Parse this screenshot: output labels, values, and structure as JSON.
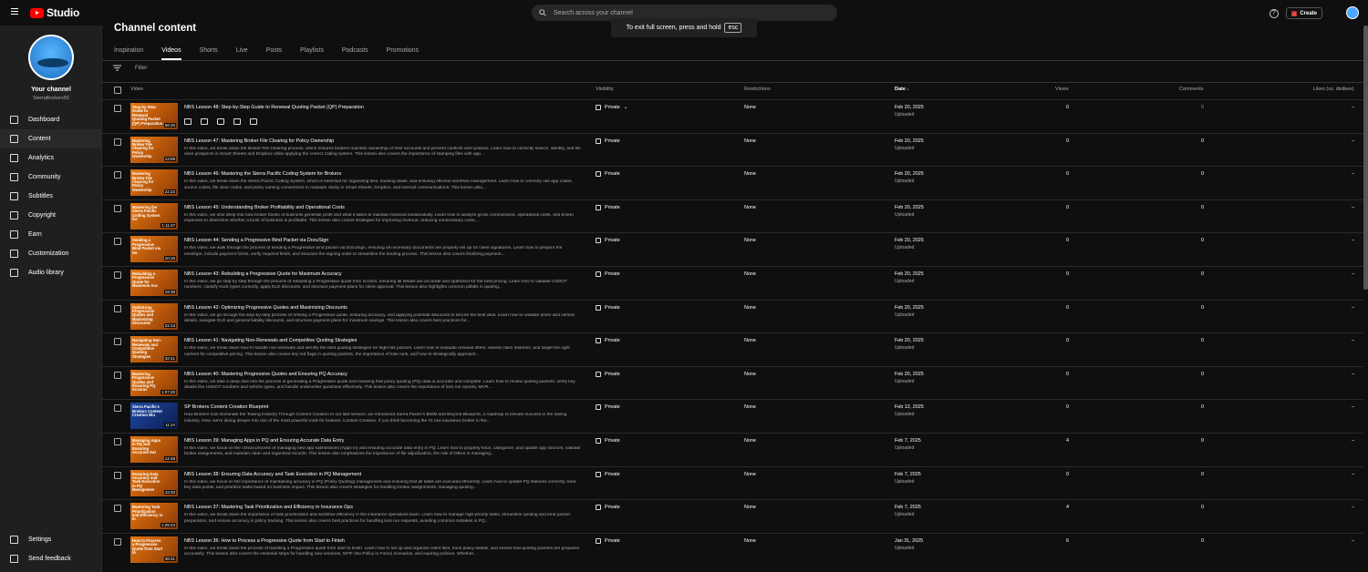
{
  "header": {
    "logo_text": "Studio",
    "search_placeholder": "Search across your channel",
    "create_label": "Create",
    "toast_text": "To exit full screen, press and hold",
    "toast_key": "esc"
  },
  "sidebar": {
    "channel_title": "Your channel",
    "channel_handle": "SierraBrokers50",
    "items": [
      {
        "label": "Dashboard",
        "icon": "dashboard-icon"
      },
      {
        "label": "Content",
        "icon": "content-icon",
        "active": true
      },
      {
        "label": "Analytics",
        "icon": "analytics-icon"
      },
      {
        "label": "Community",
        "icon": "community-icon"
      },
      {
        "label": "Subtitles",
        "icon": "subtitles-icon"
      },
      {
        "label": "Copyright",
        "icon": "copyright-icon"
      },
      {
        "label": "Earn",
        "icon": "earn-icon"
      },
      {
        "label": "Customization",
        "icon": "customization-icon"
      },
      {
        "label": "Audio library",
        "icon": "audio-library-icon"
      }
    ],
    "bottom_items": [
      {
        "label": "Settings",
        "icon": "settings-icon"
      },
      {
        "label": "Send feedback",
        "icon": "feedback-icon"
      }
    ]
  },
  "main": {
    "title": "Channel content",
    "tabs": [
      "Inspiration",
      "Videos",
      "Shorts",
      "Live",
      "Posts",
      "Playlists",
      "Podcasts",
      "Promotions"
    ],
    "active_tab": "Videos",
    "filter_placeholder": "Filter",
    "columns": {
      "video": "Video",
      "visibility": "Visibility",
      "restrictions": "Restrictions",
      "date": "Date",
      "views": "Views",
      "comments": "Comments",
      "likes": "Likes (vs. dislikes)"
    },
    "rows": [
      {
        "title": "NBS Lesson 48: Step-by-Step Guide to Renewal Quoting Packet (QP) Preparation",
        "desc": "",
        "thumb": "Step-by-Step Guide to Renewal Quoting Packet (QP) Preparation",
        "duration": "56:20",
        "visibility": "Private",
        "restrictions": "None",
        "date": "Feb 20, 2025",
        "status": "Uploaded",
        "views": "0",
        "comments": "0",
        "likes": "–"
      },
      {
        "title": "NBS Lesson 47: Mastering Broker File Clearing for Policy Ownership",
        "desc": "In this video, we break down the Broker File Clearing process, which ensures brokers maintain ownership of their accounts and prevent conflicts over policies. Learn how to correctly search, identify, and file clear prospects in Smart Sheets and Dropbox while applying the correct coding system. This lesson also covers the importance of stamping files with app...",
        "thumb": "Mastering Broker File Clearing for Policy Ownership",
        "duration": "13:59",
        "visibility": "Private",
        "restrictions": "None",
        "date": "Feb 20, 2025",
        "status": "Uploaded",
        "views": "0",
        "comments": "0",
        "likes": "–"
      },
      {
        "title": "NBS Lesson 46: Mastering the Sierra Pacific Coding System for Brokers",
        "desc": "In this video, we break down the Sierra Pacific Coding System, which is essential for organizing files, tracking deals, and ensuring efficient workflow management. Learn how to correctly use app codes, source codes, file clear codes, and policy naming conventions to maintain clarity in Smart Sheets, Dropbox, and internal communications. This lesson also...",
        "thumb": "Mastering Broker File Clearing for Policy Ownership",
        "duration": "22:22",
        "visibility": "Private",
        "restrictions": "None",
        "date": "Feb 20, 2025",
        "status": "Uploaded",
        "views": "0",
        "comments": "0",
        "likes": "–"
      },
      {
        "title": "NBS Lesson 45: Understanding Broker Profitability and Operational Costs",
        "desc": "In this video, we dive deep into how broker books of business generate profit and what it takes to maintain financial sustainability. Learn how to analyze gross commissions, operational costs, and broker expenses to determine whether a book of business is profitable. This lesson also covers strategies for improving revenue, reducing unnecessary costs,...",
        "thumb": "Mastering the Sierra Pacific Coding System for",
        "duration": "1:11:47",
        "visibility": "Private",
        "restrictions": "None",
        "date": "Feb 20, 2025",
        "status": "Uploaded",
        "views": "0",
        "comments": "0",
        "likes": "–"
      },
      {
        "title": "NBS Lesson 44: Sending a Progressive Bind Packet via DocuSign",
        "desc": "In this video, we walk through the process of sending a Progressive bind packet via DocuSign, ensuring all necessary documents are properly set up for client signatures. Learn how to prepare the envelope, include payment forms, verify required fields, and structure the signing order to streamline the binding process. This lesson also covers finalizing payment...",
        "thumb": "Sending a Progressive Bind Packet via Do",
        "duration": "10:16",
        "visibility": "Private",
        "restrictions": "None",
        "date": "Feb 20, 2025",
        "status": "Uploaded",
        "views": "0",
        "comments": "0",
        "likes": "–"
      },
      {
        "title": "NBS Lesson 43: Rebuilding a Progressive Quote for Maximum Accuracy",
        "desc": "In this video, we go step by step through the process of rebuilding a Progressive quote from scratch, ensuring all details are accurate and optimized for the best pricing. Learn how to validate USDOT numbers, classify truck types correctly, apply ELD discounts, and structure payment plans for client approval. This lesson also highlights common pitfalls in quoting...",
        "thumb": "Rebuilding a Progressive Quote for Maximum Acc",
        "duration": "19:39",
        "visibility": "Private",
        "restrictions": "None",
        "date": "Feb 20, 2025",
        "status": "Uploaded",
        "views": "0",
        "comments": "0",
        "likes": "–"
      },
      {
        "title": "NBS Lesson 42: Optimizing Progressive Quotes and Maximizing Discounts",
        "desc": "In this video, we go through the step-by-step process of refining a Progressive quote, ensuring accuracy, and applying potential discounts to secure the best deal. Learn how to validate driver and vehicle details, navigate ELD and general liability discounts, and structure payment plans for maximum savings. This lesson also covers best practices for...",
        "thumb": "Optimizing Progressive Quotes and Maximizing Discounts",
        "duration": "22:13",
        "visibility": "Private",
        "restrictions": "None",
        "date": "Feb 20, 2025",
        "status": "Uploaded",
        "views": "0",
        "comments": "0",
        "likes": "–"
      },
      {
        "title": "NBS Lesson 41: Navigating Non-Renewals and Competitive Quoting Strategies",
        "desc": "In this video, we break down how to handle non-renewals and identify the best quoting strategies for high-risk policies. Learn how to evaluate renewal offers, assess claim histories, and target the right carriers for competitive pricing. This lesson also covers key red flags in quoting packets, the importance of loss runs, and how to strategically approach...",
        "thumb": "Navigating Non-Renewals and Competitive Quoting Strategies",
        "duration": "42:41",
        "visibility": "Private",
        "restrictions": "None",
        "date": "Feb 20, 2025",
        "status": "Uploaded",
        "views": "0",
        "comments": "0",
        "likes": "–"
      },
      {
        "title": "NBS Lesson 40: Mastering Progressive Quotes and Ensuring PQ Accuracy",
        "desc": "In this video, we take a deep dive into the process of generating a Progressive quote and ensuring that policy quoting (PQ) data is accurate and complete. Learn how to review quoting packets, verify key details like USDOT numbers and vehicle types, and handle underwriter questions effectively. This lesson also covers the importance of loss run reports, MVR...",
        "thumb": "Mastering Progressive Quotes and Ensuring PQ Accurac",
        "duration": "1:07:20",
        "visibility": "Private",
        "restrictions": "None",
        "date": "Feb 20, 2025",
        "status": "Uploaded",
        "views": "0",
        "comments": "0",
        "likes": "–"
      },
      {
        "title": "SP Brokers Content Creation Blueprint",
        "desc": "How Brokers Can Dominate the Towing Industry Through Content Creation In our last session, we introduced Sierra Pacific's $50M and Beyond Blueprint, a roadmap to elevate success in the towing industry. Now, we're diving deeper into one of the most powerful tools for brokers: Content Creation. If you think becoming the #1 tow insurance broker in the...",
        "thumb": "Sierra Pacific's Brokers Content Creation Blu",
        "duration": "11:24",
        "blue": true,
        "visibility": "Private",
        "restrictions": "None",
        "date": "Feb 12, 2025",
        "status": "Uploaded",
        "views": "0",
        "comments": "0",
        "likes": "–"
      },
      {
        "title": "NBS Lesson 39: Managing Apps in PQ and Ensuring Accurate Data Entry",
        "desc": "In this video, we focus on the critical process of managing new app submissions (Apps In) and ensuring accurate data entry in PQ. Learn how to properly track, categorize, and update app sources, validate broker assignments, and maintain clean and organized records. This lesson also emphasizes the importance of file adjudication, the role of OBAs in managing...",
        "thumb": "Managing Apps in PQ and Ensuring Accurate Dat",
        "duration": "14:48",
        "visibility": "Private",
        "restrictions": "None",
        "date": "Feb 7, 2025",
        "status": "Uploaded",
        "views": "4",
        "comments": "0",
        "likes": "–"
      },
      {
        "title": "NBS Lesson 38: Ensuring Data Accuracy and Task Execution in PQ Management",
        "desc": "In this video, we focus on the importance of maintaining accuracy in PQ (Policy Quoting) management and ensuring that all tasks are executed efficiently. Learn how to update PQ statuses correctly, track key data points, and prioritize tasks based on business impact. This lesson also covers strategies for handling broker assignments, managing quoting...",
        "thumb": "Ensuring Data Accuracy and Task Execution in PQ Managemen",
        "duration": "43:33",
        "visibility": "Private",
        "restrictions": "None",
        "date": "Feb 7, 2025",
        "status": "Uploaded",
        "views": "0",
        "comments": "0",
        "likes": "–"
      },
      {
        "title": "NBS Lesson 37: Mastering Task Prioritization and Efficiency in Insurance Ops",
        "desc": "In this video, we break down the importance of task prioritization and workflow efficiency in the insurance operations team. Learn how to manage high-priority tasks, streamline quoting and bind packet preparation, and ensure accuracy in policy tracking. This lesson also covers best practices for handling loss run requests, avoiding common mistakes in PQ...",
        "thumb": "Mastering Task Prioritization and Efficiency in In",
        "duration": "1:29:23",
        "visibility": "Private",
        "restrictions": "None",
        "date": "Feb 7, 2025",
        "status": "Uploaded",
        "views": "4",
        "comments": "0",
        "likes": "–"
      },
      {
        "title": "NBS Lesson 36: How to Process a Progressive Quote from Start to Finish",
        "desc": "In this video, we break down the process of handling a Progressive quote from start to finish. Learn how to set up and organize client files, track policy details, and ensure that quoting packets are prepared accurately. This lesson also covers the essential steps for handling new ventures, NPIF (No Policy in Force) scenarios, and expiring policies. Whether...",
        "thumb": "How to Process a Progressive Quote from Start to",
        "duration": "38:31",
        "visibility": "Private",
        "restrictions": "None",
        "date": "Jan 31, 2025",
        "status": "Uploaded",
        "views": "6",
        "comments": "0",
        "likes": "–"
      }
    ]
  }
}
